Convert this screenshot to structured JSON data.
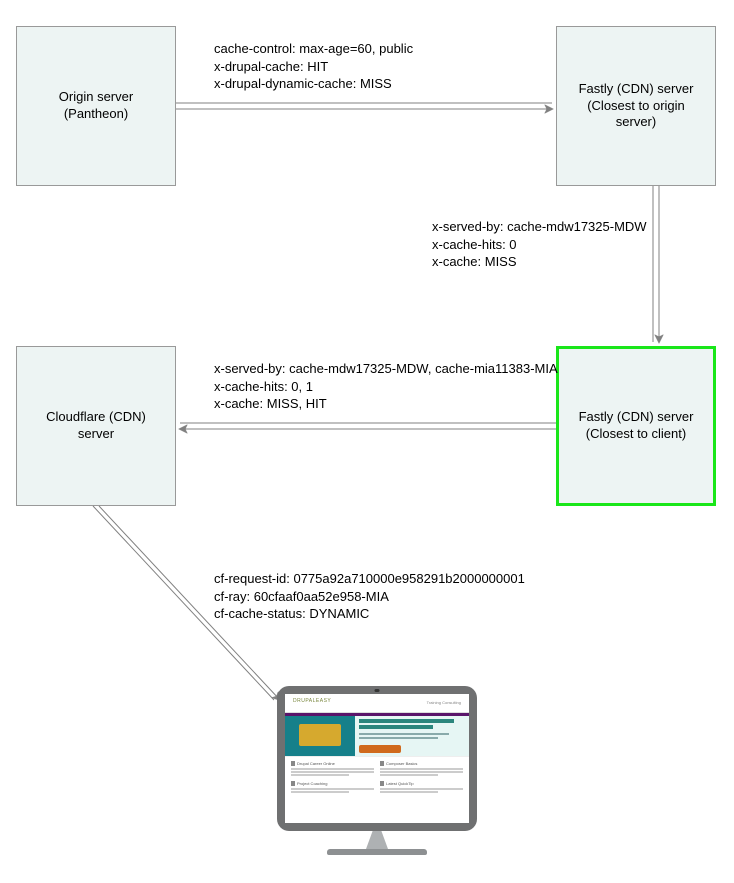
{
  "nodes": {
    "origin": {
      "line1": "Origin server",
      "line2": "(Pantheon)"
    },
    "fastly_origin": {
      "line1": "Fastly (CDN) server",
      "line2": "(Closest to origin",
      "line3": "server)"
    },
    "fastly_client": {
      "line1": "Fastly (CDN) server",
      "line2": "(Closest to client)"
    },
    "cloudflare": {
      "line1": "Cloudflare (CDN)",
      "line2": "server"
    }
  },
  "edges": {
    "origin_to_fastly": {
      "l1": "cache-control: max-age=60, public",
      "l2": "x-drupal-cache: HIT",
      "l3": "x-drupal-dynamic-cache: MISS"
    },
    "fastly_origin_to_client": {
      "l1": "x-served-by: cache-mdw17325-MDW",
      "l2": "x-cache-hits: 0",
      "l3": "x-cache: MISS"
    },
    "fastly_client_to_cf": {
      "l1": "x-served-by: cache-mdw17325-MDW, cache-mia11383-MIA",
      "l2": "x-cache-hits: 0, 1",
      "l3": "x-cache: MISS, HIT"
    },
    "cf_to_client": {
      "l1": "cf-request-id: 0775a92a710000e958291b2000000001",
      "l2": "cf-ray: 60cfaaf0aa52e958-MIA",
      "l3": "cf-cache-status: DYNAMIC"
    }
  },
  "client_screen": {
    "brand": "DRUPALEASY",
    "nav": "Training   Consulting",
    "cols": [
      "Drupal Career Online",
      "Composer Basics",
      "Project Coaching",
      "Latest QuickTip"
    ]
  }
}
